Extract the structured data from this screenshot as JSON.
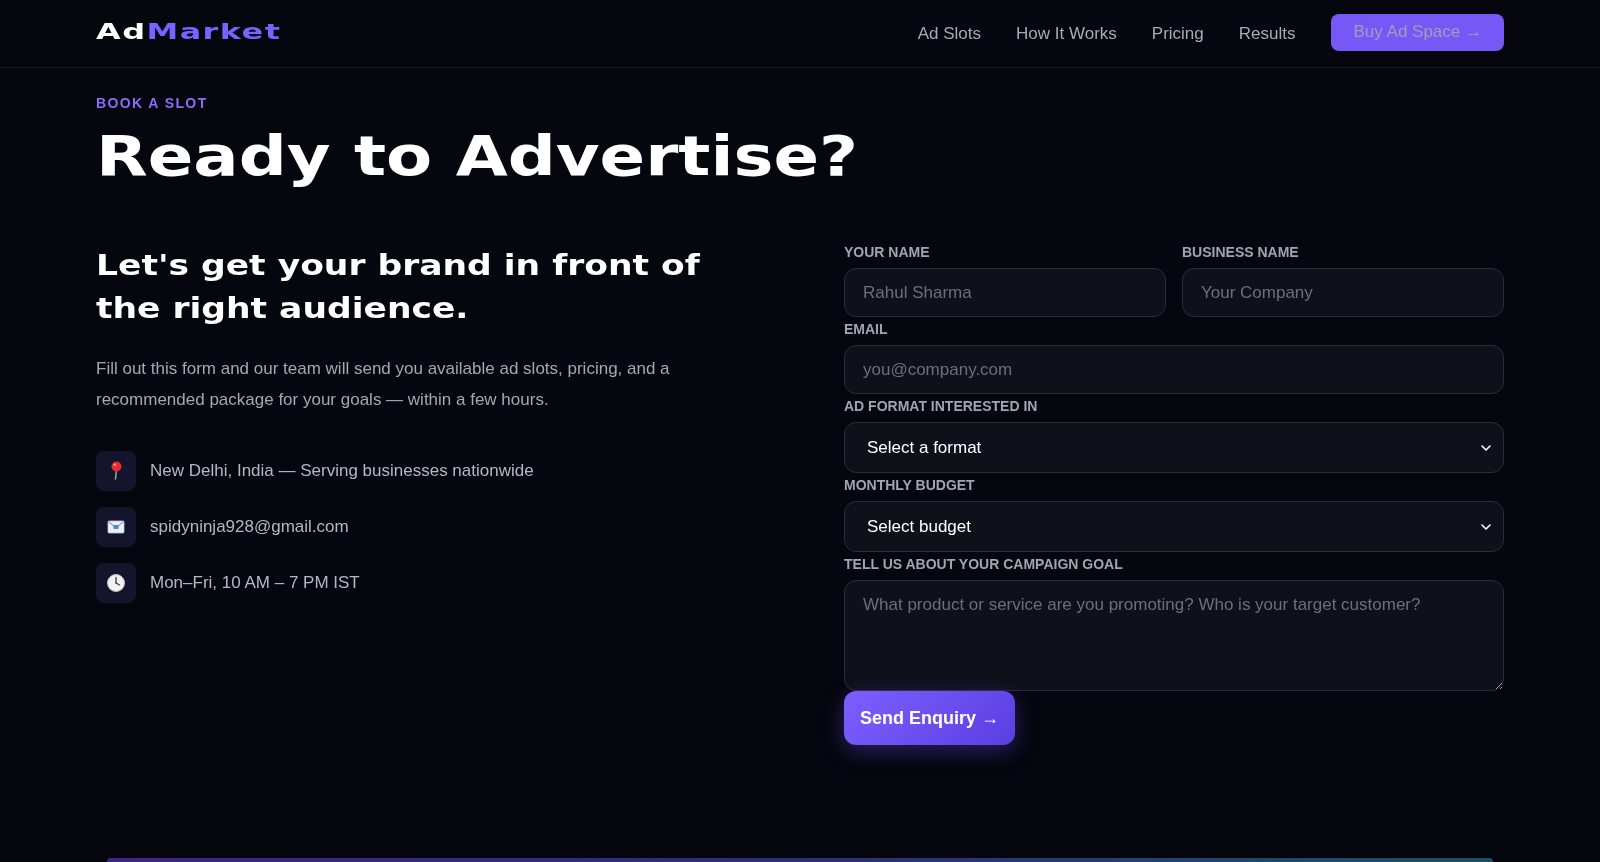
{
  "nav": {
    "logo": {
      "text": "Ad",
      "accent": "Market"
    },
    "links": [
      "Ad Slots",
      "How It Works",
      "Pricing",
      "Results"
    ],
    "cta": "Buy Ad Space →"
  },
  "hero": {
    "eyebrow": "BOOK A SLOT",
    "title": "Ready to Advertise?"
  },
  "intro": {
    "heading": "Let's get your brand in front of the right audience.",
    "text": "Fill out this form and our team will send you available ad slots, pricing, and a recommended package for your goals — within a few hours.",
    "contacts": [
      {
        "kind": "location",
        "text": "New Delhi, India — Serving businesses nationwide"
      },
      {
        "kind": "email",
        "text": "spidyninja928@gmail.com"
      },
      {
        "kind": "hours",
        "text": "Mon–Fri, 10 AM – 7 PM IST"
      }
    ]
  },
  "form": {
    "rows": [
      [
        {
          "kind": "text",
          "label": "YOUR NAME",
          "placeholder": "Rahul Sharma"
        },
        {
          "kind": "text",
          "label": "BUSINESS NAME",
          "placeholder": "Your Company"
        }
      ],
      [
        {
          "kind": "text",
          "label": "EMAIL",
          "placeholder": "you@company.com"
        }
      ],
      [
        {
          "kind": "select",
          "label": "AD FORMAT INTERESTED IN",
          "value": "Select a format"
        }
      ],
      [
        {
          "kind": "select",
          "label": "MONTHLY BUDGET",
          "value": "Select budget"
        }
      ],
      [
        {
          "kind": "textarea",
          "label": "TELL US ABOUT YOUR CAMPAIGN GOAL",
          "placeholder": "What product or service are you promoting? Who is your target customer?"
        }
      ]
    ],
    "submit": "Send Enquiry →"
  }
}
